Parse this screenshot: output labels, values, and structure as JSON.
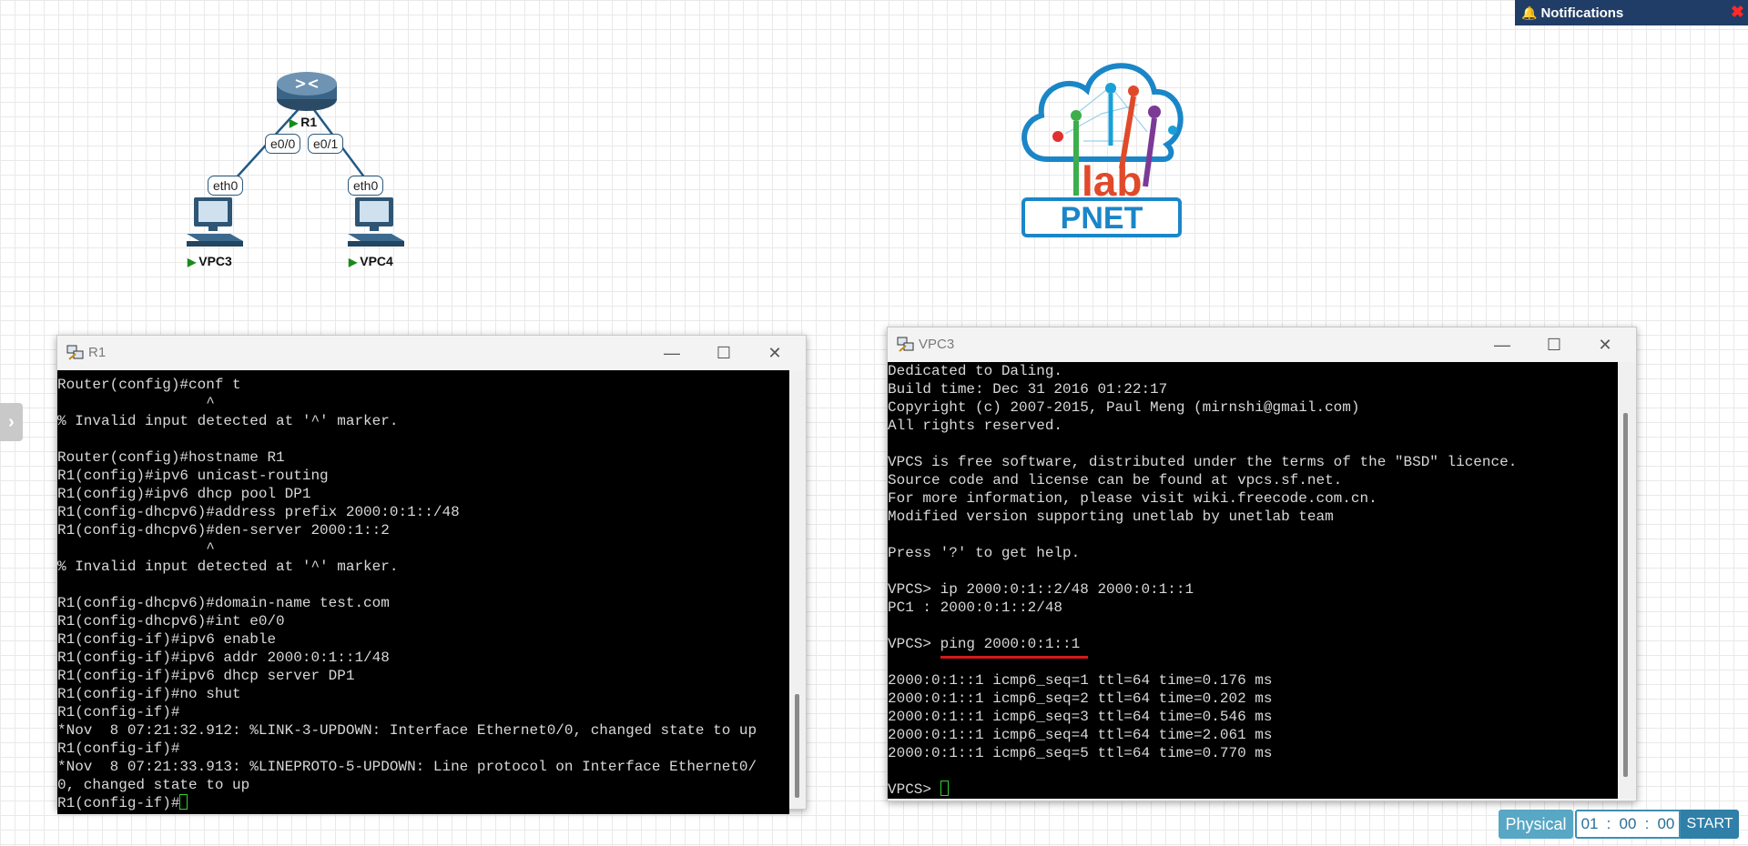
{
  "notifications": {
    "title": "Notifications",
    "close": "✖"
  },
  "topology": {
    "r1": {
      "name": "R1"
    },
    "vpc3": {
      "name": "VPC3",
      "port": "eth0"
    },
    "vpc4": {
      "name": "VPC4",
      "port": "eth0"
    },
    "r1_ports": {
      "left": "e0/0",
      "right": "e0/1"
    }
  },
  "logo": {
    "text_top": "lab",
    "text_bottom": "PNET"
  },
  "r1_window": {
    "title": "R1",
    "lines": [
      "Router(config)#conf t",
      "                 ^",
      "% Invalid input detected at '^' marker.",
      "",
      "Router(config)#hostname R1",
      "R1(config)#ipv6 unicast-routing",
      "R1(config)#ipv6 dhcp pool DP1",
      "R1(config-dhcpv6)#address prefix 2000:0:1::/48",
      "R1(config-dhcpv6)#den-server 2000:1::2",
      "                 ^",
      "% Invalid input detected at '^' marker.",
      "",
      "R1(config-dhcpv6)#domain-name test.com",
      "R1(config-dhcpv6)#int e0/0",
      "R1(config-if)#ipv6 enable",
      "R1(config-if)#ipv6 addr 2000:0:1::1/48",
      "R1(config-if)#ipv6 dhcp server DP1",
      "R1(config-if)#no shut",
      "R1(config-if)#",
      "*Nov  8 07:21:32.912: %LINK-3-UPDOWN: Interface Ethernet0/0, changed state to up",
      "R1(config-if)#",
      "*Nov  8 07:21:33.913: %LINEPROTO-5-UPDOWN: Line protocol on Interface Ethernet0/",
      "0, changed state to up"
    ],
    "prompt": "R1(config-if)#"
  },
  "vpc3_window": {
    "title": "VPC3",
    "lines": [
      "Dedicated to Daling.",
      "Build time: Dec 31 2016 01:22:17",
      "Copyright (c) 2007-2015, Paul Meng (mirnshi@gmail.com)",
      "All rights reserved.",
      "",
      "VPCS is free software, distributed under the terms of the \"BSD\" licence.",
      "Source code and license can be found at vpcs.sf.net.",
      "For more information, please visit wiki.freecode.com.cn.",
      "Modified version supporting unetlab by unetlab team",
      "",
      "Press '?' to get help.",
      "",
      "VPCS> ip 2000:0:1::2/48 2000:0:1::1",
      "PC1 : 2000:0:1::2/48",
      "",
      "VPCS> ping 2000:0:1::1",
      "",
      "2000:0:1::1 icmp6_seq=1 ttl=64 time=0.176 ms",
      "2000:0:1::1 icmp6_seq=2 ttl=64 time=0.202 ms",
      "2000:0:1::1 icmp6_seq=3 ttl=64 time=0.546 ms",
      "2000:0:1::1 icmp6_seq=4 ttl=64 time=2.061 ms",
      "2000:0:1::1 icmp6_seq=5 ttl=64 time=0.770 ms",
      ""
    ],
    "prompt": "VPCS> "
  },
  "bottom": {
    "physical": "Physical",
    "hours": "01",
    "minutes": "00",
    "seconds": "00",
    "start": "START"
  },
  "colors": {
    "accent": "#2f7fa8",
    "highlight": "#d41a1a",
    "cursor": "#2fd02f"
  }
}
